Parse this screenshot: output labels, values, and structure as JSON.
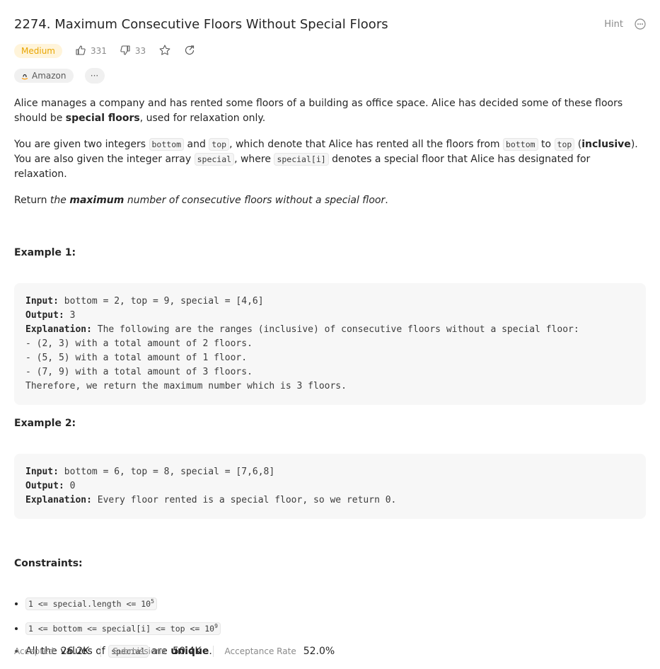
{
  "problem": {
    "title": "2274. Maximum Consecutive Floors Without Special Floors",
    "hint_label": "Hint",
    "difficulty": "Medium",
    "likes": "331",
    "dislikes": "33",
    "company_tag": "Amazon",
    "more_tags": "···"
  },
  "description": {
    "p1_a": "Alice manages a company and has rented some floors of a building as office space. Alice has decided some of these floors should be",
    "p1_bold": "special floors",
    "p1_b": ", used for relaxation only.",
    "p2_a": "You are given two integers ",
    "p2_code1": "bottom",
    "p2_b": " and ",
    "p2_code2": "top",
    "p2_c": ", which denote that Alice has rented all the floors from ",
    "p2_code3": "bottom",
    "p2_d": " to ",
    "p2_code4": "top",
    "p2_e": " (",
    "p2_bold": "inclusive",
    "p2_f": "). You are also given the integer array ",
    "p2_code5": "special",
    "p2_g": ", where ",
    "p2_code6": "special[i]",
    "p2_h": " denotes a special floor that Alice has designated for relaxation.",
    "p3_a": "Return ",
    "p3_i1": "the ",
    "p3_bold": "maximum",
    "p3_i2": " number of consecutive floors without a special floor",
    "p3_b": "."
  },
  "examples": [
    {
      "title": "Example 1:",
      "input_label": "Input:",
      "input": " bottom = 2, top = 9, special = [4,6]",
      "output_label": "Output:",
      "output": " 3",
      "explanation_label": "Explanation:",
      "explanation": " The following are the ranges (inclusive) of consecutive floors without a special floor:\n- (2, 3) with a total amount of 2 floors.\n- (5, 5) with a total amount of 1 floor.\n- (7, 9) with a total amount of 3 floors.\nTherefore, we return the maximum number which is 3 floors."
    },
    {
      "title": "Example 2:",
      "input_label": "Input:",
      "input": " bottom = 6, top = 8, special = [7,6,8]",
      "output_label": "Output:",
      "output": " 0",
      "explanation_label": "Explanation:",
      "explanation": " Every floor rented is a special floor, so we return 0."
    }
  ],
  "constraints": {
    "title": "Constraints:",
    "c1_code": "1 <= special.length <= 10",
    "c1_sup": "5",
    "c2_code": "1 <= bottom <= special[i] <= top <= 10",
    "c2_sup": "9",
    "c3_a": "All the values of ",
    "c3_code": "special",
    "c3_b": " are ",
    "c3_bold": "unique",
    "c3_c": "."
  },
  "stats": {
    "accepted_label": "Accepted",
    "accepted_value": "26.2K",
    "submissions_label": "Submissions",
    "submissions_value": "50.4K",
    "rate_label": "Acceptance Rate",
    "rate_value": "52.0%"
  },
  "colors": {
    "difficulty_medium": "#e8a500",
    "difficulty_bg": "#fff4da",
    "amazon_orange": "#ff9900"
  },
  "icons": [
    "thumbs-up-icon",
    "thumbs-down-icon",
    "star-icon",
    "share-icon",
    "more-icon",
    "amazon-icon"
  ]
}
